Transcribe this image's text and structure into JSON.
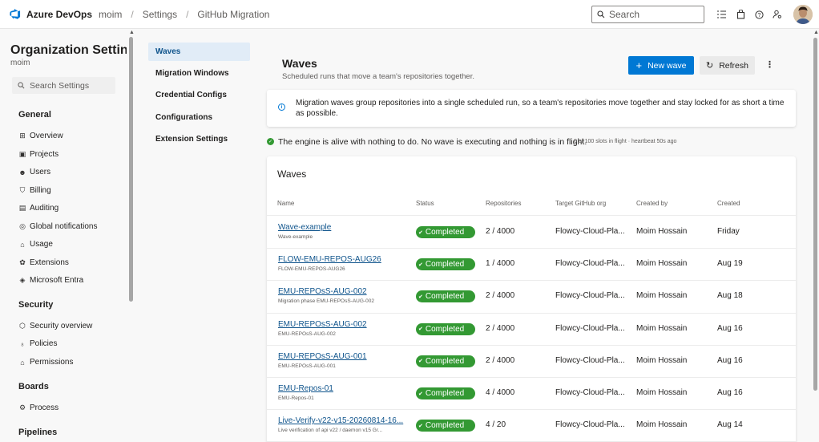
{
  "header": {
    "brand": "Azure DevOps",
    "breadcrumbs": [
      "moim",
      "Settings",
      "GitHub Migration"
    ],
    "search_placeholder": "Search"
  },
  "leftnav": {
    "title": "Organization Settings",
    "org": "moim",
    "search_placeholder": "Search Settings",
    "sections": [
      {
        "label": "General",
        "items": [
          {
            "label": "Overview",
            "icon": "overview-icon"
          },
          {
            "label": "Projects",
            "icon": "projects-icon"
          },
          {
            "label": "Users",
            "icon": "users-icon"
          },
          {
            "label": "Billing",
            "icon": "billing-icon"
          },
          {
            "label": "Auditing",
            "icon": "auditing-icon"
          },
          {
            "label": "Global notifications",
            "icon": "notifications-icon"
          },
          {
            "label": "Usage",
            "icon": "usage-icon"
          },
          {
            "label": "Extensions",
            "icon": "extensions-icon"
          },
          {
            "label": "Microsoft Entra",
            "icon": "entra-icon"
          }
        ]
      },
      {
        "label": "Security",
        "items": [
          {
            "label": "Security overview",
            "icon": "shield-icon"
          },
          {
            "label": "Policies",
            "icon": "policies-icon"
          },
          {
            "label": "Permissions",
            "icon": "lock-icon"
          }
        ]
      },
      {
        "label": "Boards",
        "items": [
          {
            "label": "Process",
            "icon": "process-icon"
          }
        ]
      },
      {
        "label": "Pipelines",
        "items": []
      }
    ]
  },
  "subnav": {
    "items": [
      "Waves",
      "Migration Windows",
      "Credential Configs",
      "Configurations",
      "Extension Settings"
    ],
    "active": "Waves"
  },
  "main": {
    "title": "Waves",
    "subtitle": "Scheduled runs that move a team's repositories together.",
    "new_wave_label": "New wave",
    "refresh_label": "Refresh",
    "info_text": "Migration waves group repositories into a single scheduled run, so a team's repositories move together and stay locked for as short a time as possible.",
    "status_text": "The engine is alive with nothing to do. No wave is executing and nothing is in flight.",
    "status_meta": "0 of 100 slots in flight · heartbeat 50s ago",
    "table": {
      "title": "Waves",
      "columns": [
        "Name",
        "Status",
        "Repositories",
        "Target GitHub org",
        "Created by",
        "Created"
      ],
      "rows": [
        {
          "name": "Wave-example",
          "desc": "Wave-example",
          "status": "Completed",
          "repos": "2 / 4000",
          "org": "Flowcy-Cloud-Pla...",
          "by": "Moim Hossain",
          "created": "Friday"
        },
        {
          "name": "FLOW-EMU-REPOS-AUG26",
          "desc": "FLOW-EMU-REPOS-AUG26",
          "status": "Completed",
          "repos": "1 / 4000",
          "org": "Flowcy-Cloud-Pla...",
          "by": "Moim Hossain",
          "created": "Aug 19"
        },
        {
          "name": "EMU-REPOsS-AUG-002",
          "desc": "Migration phase EMU-REPOsS-AUG-002",
          "status": "Completed",
          "repos": "2 / 4000",
          "org": "Flowcy-Cloud-Pla...",
          "by": "Moim Hossain",
          "created": "Aug 18"
        },
        {
          "name": "EMU-REPOsS-AUG-002",
          "desc": "EMU-REPOsS-AUG-002",
          "status": "Completed",
          "repos": "2 / 4000",
          "org": "Flowcy-Cloud-Pla...",
          "by": "Moim Hossain",
          "created": "Aug 16"
        },
        {
          "name": "EMU-REPOsS-AUG-001",
          "desc": "EMU-REPOsS-AUG-001",
          "status": "Completed",
          "repos": "2 / 4000",
          "org": "Flowcy-Cloud-Pla...",
          "by": "Moim Hossain",
          "created": "Aug 16"
        },
        {
          "name": "EMU-Repos-01",
          "desc": "EMU-Repos-01",
          "status": "Completed",
          "repos": "4 / 4000",
          "org": "Flowcy-Cloud-Pla...",
          "by": "Moim Hossain",
          "created": "Aug 16"
        },
        {
          "name": "Live-Verify-v22-v15-20260814-16...",
          "desc": "Live verification of api v22 / daemon v15 Gr...",
          "status": "Completed",
          "repos": "4 / 20",
          "org": "Flowcy-Cloud-Pla...",
          "by": "Moim Hossain",
          "created": "Aug 14"
        }
      ]
    }
  },
  "colors": {
    "accent": "#0078d4",
    "success": "#339933",
    "link": "#0f548c"
  }
}
